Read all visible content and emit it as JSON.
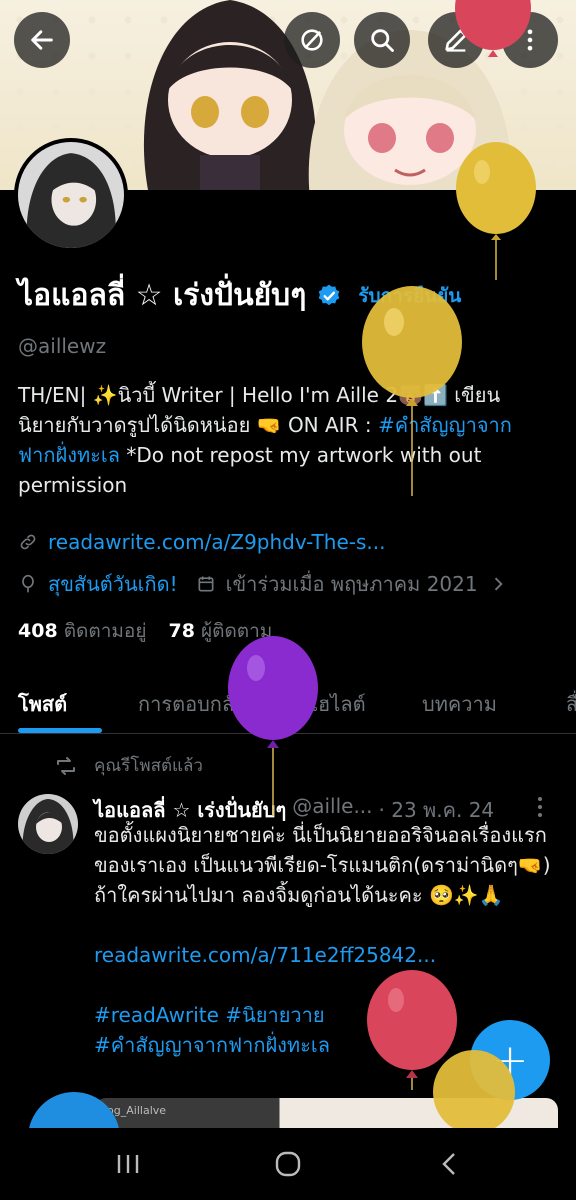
{
  "profile": {
    "name": "ไอแอลลี่ ☆ เร่งปั่นยับๆ",
    "verify_label": "รับการยืนยัน",
    "handle": "@aillewz",
    "bio_text": "TH/EN| ✨นิวบี้ Writer | Hello I'm Aille 2🐻⬆️ เขียนนิยายกับวาดรูปได้นิดหน่อย 🤜 ON AIR : ",
    "bio_hashtag": "#คำสัญญาจากฟากฝั่งทะเล",
    "bio_tail": " *Do not repost my artwork with out permission",
    "website": "readawrite.com/a/Z9phdv-The-s...",
    "birthday": "สุขสันต์วันเกิด!",
    "joined": "เข้าร่วมเมื่อ พฤษภาคม 2021",
    "following_count": "408",
    "following_label": "ติดตามอยู่",
    "followers_count": "78",
    "followers_label": "ผู้ติดตาม"
  },
  "tabs": [
    {
      "label": "โพสต์"
    },
    {
      "label": "การตอบกลับ"
    },
    {
      "label": "ไฮไลต์"
    },
    {
      "label": "บทความ"
    },
    {
      "label": "สื่อ"
    }
  ],
  "post": {
    "repost_label": "คุณรีโพสต์แล้ว",
    "author_name": "ไอแอลลี่ ☆ เร่งปั่นยับๆ",
    "author_handle": "@aille...",
    "date": "· 23 พ.ค. 24",
    "line1": "ขอตั้งแผงนิยายชายค่ะ นี่เป็นนิยายออริจินอลเรื่องแรกของเราเอง เป็นแนวพีเรียด-โรแมนติก(ดราม่านิดๆ🤜)",
    "line2": "ถ้าใครผ่านไปมา ลองจิ้มดูก่อนได้นะคะ 🥺✨🙏",
    "link": "readawrite.com/a/711e2ff25842...",
    "hashtags1": "#readAwrite #นิยายวาย",
    "hashtags2": "#คำสัญญาจากฟากฝั่งทะเล",
    "media_caption": "log_Aillalve"
  },
  "fab_label": "+",
  "colors": {
    "accent": "#1d9bf0",
    "background": "#000000",
    "text": "#e7e9ea",
    "muted": "#71767b"
  }
}
